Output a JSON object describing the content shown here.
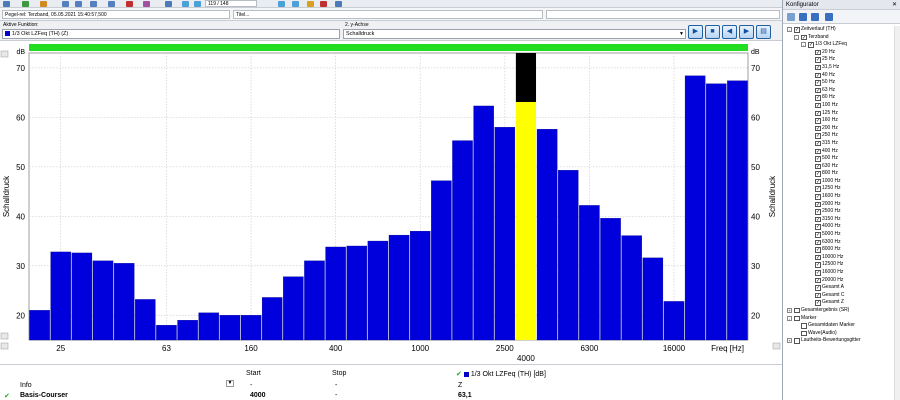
{
  "toolbar": {
    "counter": "119 / 148",
    "text_field": "Titel..."
  },
  "titlebar": {
    "file_title": "Pegel-rel: Terzband, 05.05.2021 15:40:57,500",
    "title_field": "Titel..."
  },
  "funcbar": {
    "active_label": "Aktive Funktion:",
    "active_value": "1/3 Okt LZFeq (TH) (Z)",
    "yaxis_label": "2. y-Achse",
    "yaxis_value": "Schalldruck"
  },
  "chart_data": {
    "type": "bar",
    "categories": [
      "20 Hz",
      "25 Hz",
      "31,5 Hz",
      "40 Hz",
      "50 Hz",
      "63 Hz",
      "80 Hz",
      "100 Hz",
      "125 Hz",
      "160 Hz",
      "200 Hz",
      "250 Hz",
      "315 Hz",
      "400 Hz",
      "500 Hz",
      "630 Hz",
      "800 Hz",
      "1000 Hz",
      "1250 Hz",
      "1600 Hz",
      "2000 Hz",
      "2500 Hz",
      "3150 Hz",
      "4000 Hz",
      "5000 Hz",
      "6300 Hz",
      "8000 Hz",
      "10000 Hz",
      "12500 Hz",
      "16000 Hz",
      "20000 Hz",
      "Gesamt A",
      "Gesamt C",
      "Gesamt Z"
    ],
    "values": [
      21.0,
      32.8,
      32.6,
      31.0,
      30.5,
      23.2,
      18.0,
      19.0,
      20.5,
      20.0,
      20.0,
      23.6,
      27.8,
      31.0,
      33.8,
      34.0,
      35.0,
      36.2,
      37.0,
      47.2,
      55.3,
      62.3,
      58.0,
      63.1,
      57.6,
      49.3,
      42.2,
      39.6,
      36.1,
      31.6,
      22.8,
      68.4,
      66.8,
      67.4
    ],
    "cursor_index": 23,
    "cursor_value_label": "4000",
    "ylabel": "Schalldruck",
    "yunit": "dB",
    "xunit": "Freq [Hz]",
    "ylim": [
      15,
      73
    ],
    "yticks": [
      20,
      30,
      40,
      50,
      60,
      70
    ],
    "xtick_labels": [
      {
        "index": 1,
        "label": "25"
      },
      {
        "index": 6,
        "label": "63"
      },
      {
        "index": 10,
        "label": "160"
      },
      {
        "index": 14,
        "label": "400"
      },
      {
        "index": 18,
        "label": "1000"
      },
      {
        "index": 22,
        "label": "2500"
      },
      {
        "index": 26,
        "label": "6300"
      },
      {
        "index": 30,
        "label": "16000"
      }
    ],
    "bar_color": "#0000dd",
    "cursor_color": "#ffff00",
    "overload_color": "#000000",
    "status_color": "#22dd22",
    "grid": true
  },
  "cursor_panel": {
    "col_start": "Start",
    "col_stop": "Stop",
    "series_label": "1/3 Okt LZFeq (TH) [dB]",
    "row_info_label": "Info",
    "row_info_start": "-",
    "row_info_stop": "-",
    "row_info_value": "Z",
    "row_cursor_label": "Basis-Courser",
    "row_cursor_start": "4000",
    "row_cursor_stop": "-",
    "row_cursor_value": "63,1"
  },
  "config": {
    "title": "Konfigurator",
    "tree": [
      {
        "level": 0,
        "label": "Zeitverlauf (TH)",
        "checked": true,
        "exp": "-"
      },
      {
        "level": 1,
        "label": "Terzband",
        "checked": true,
        "exp": "-"
      },
      {
        "level": 2,
        "label": "1/3 Okt LZFeq",
        "checked": true,
        "exp": "-"
      },
      {
        "level": 3,
        "label": "20 Hz",
        "checked": true
      },
      {
        "level": 3,
        "label": "25 Hz",
        "checked": true
      },
      {
        "level": 3,
        "label": "31,5 Hz",
        "checked": true
      },
      {
        "level": 3,
        "label": "40 Hz",
        "checked": true
      },
      {
        "level": 3,
        "label": "50 Hz",
        "checked": true
      },
      {
        "level": 3,
        "label": "63 Hz",
        "checked": true
      },
      {
        "level": 3,
        "label": "80 Hz",
        "checked": true
      },
      {
        "level": 3,
        "label": "100 Hz",
        "checked": true
      },
      {
        "level": 3,
        "label": "125 Hz",
        "checked": true
      },
      {
        "level": 3,
        "label": "160 Hz",
        "checked": true
      },
      {
        "level": 3,
        "label": "200 Hz",
        "checked": true
      },
      {
        "level": 3,
        "label": "250 Hz",
        "checked": true
      },
      {
        "level": 3,
        "label": "315 Hz",
        "checked": true
      },
      {
        "level": 3,
        "label": "400 Hz",
        "checked": true
      },
      {
        "level": 3,
        "label": "500 Hz",
        "checked": true
      },
      {
        "level": 3,
        "label": "630 Hz",
        "checked": true
      },
      {
        "level": 3,
        "label": "800 Hz",
        "checked": true
      },
      {
        "level": 3,
        "label": "1000 Hz",
        "checked": true
      },
      {
        "level": 3,
        "label": "1250 Hz",
        "checked": true
      },
      {
        "level": 3,
        "label": "1600 Hz",
        "checked": true
      },
      {
        "level": 3,
        "label": "2000 Hz",
        "checked": true
      },
      {
        "level": 3,
        "label": "2500 Hz",
        "checked": true
      },
      {
        "level": 3,
        "label": "3150 Hz",
        "checked": true
      },
      {
        "level": 3,
        "label": "4000 Hz",
        "checked": true
      },
      {
        "level": 3,
        "label": "5000 Hz",
        "checked": true
      },
      {
        "level": 3,
        "label": "6300 Hz",
        "checked": true
      },
      {
        "level": 3,
        "label": "8000 Hz",
        "checked": true
      },
      {
        "level": 3,
        "label": "10000 Hz",
        "checked": true
      },
      {
        "level": 3,
        "label": "12500 Hz",
        "checked": true
      },
      {
        "level": 3,
        "label": "16000 Hz",
        "checked": true
      },
      {
        "level": 3,
        "label": "20000 Hz",
        "checked": true
      },
      {
        "level": 3,
        "label": "Gesamt A",
        "checked": true
      },
      {
        "level": 3,
        "label": "Gesamt C",
        "checked": true
      },
      {
        "level": 3,
        "label": "Gesamt Z",
        "checked": true
      },
      {
        "level": 0,
        "label": "Gesamtergebnis (SR)",
        "checked": false,
        "exp": "+"
      },
      {
        "level": 0,
        "label": "Marker",
        "checked": false,
        "exp": "-"
      },
      {
        "level": 1,
        "label": "Gesamtdaten Marker",
        "checked": false
      },
      {
        "level": 1,
        "label": "Wave(Audio)",
        "checked": false
      },
      {
        "level": 0,
        "label": "Lautheits-Bewertungsgitter",
        "checked": false,
        "exp": "+"
      }
    ]
  }
}
